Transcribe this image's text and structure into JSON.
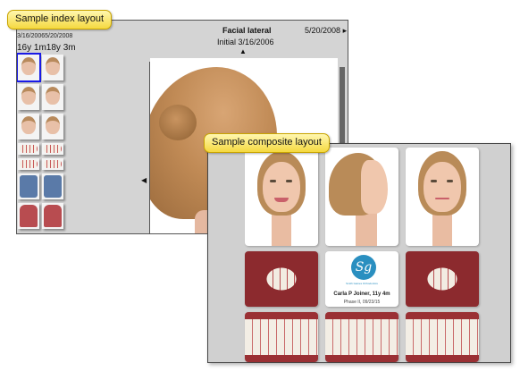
{
  "callouts": {
    "index": "Sample index layout",
    "composite": "Sample composite layout"
  },
  "index_layout": {
    "left_dates": "3/16/20065/20/2008",
    "left_ages": "16y 1m18y 3m",
    "view_title": "Facial lateral",
    "view_subtitle": "Initial 3/16/2006",
    "right_date": "5/20/2008",
    "next_arrow": "▸",
    "up_arrow": "▲",
    "left_arrow": "◀",
    "thumbnails": [
      "face-profile",
      "face-profile",
      "face-frontal",
      "face-frontal",
      "face-smile",
      "face-smile",
      "teeth-upper",
      "teeth-upper",
      "teeth-front",
      "teeth-front",
      "model-cast",
      "model-cast",
      "teeth-lower",
      "teeth-lower"
    ]
  },
  "composite_layout": {
    "logo_text": "Sg",
    "logo_caption": "Smith Gaines Orthodontics",
    "patient_name": "Carla P Joiner, 11y 4m",
    "patient_phase": "Phase II, 09/23/15"
  },
  "colors": {
    "callout_fill": "#f5d940",
    "selection_outline": "#1a1ae6",
    "logo_blue": "#2a8fc0",
    "window_bg": "#d4d4d4"
  }
}
